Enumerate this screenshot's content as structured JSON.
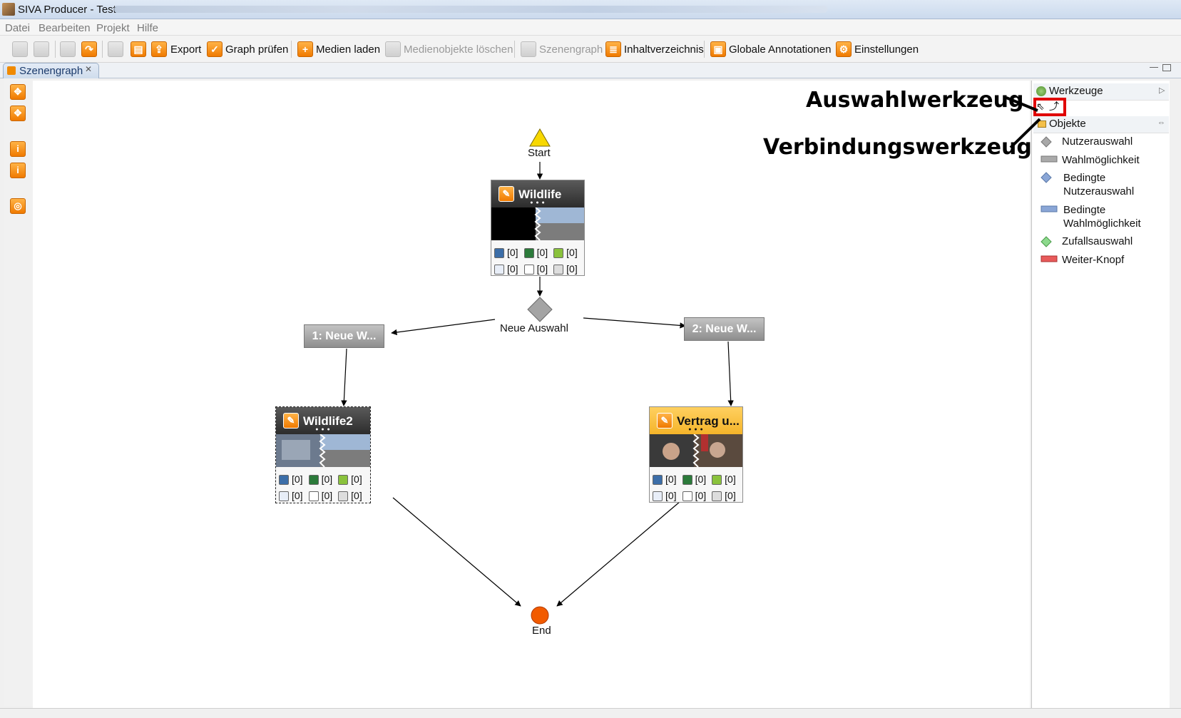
{
  "window": {
    "title": "SIVA Producer - Test"
  },
  "menu": [
    "Datei",
    "Bearbeiten",
    "Projekt",
    "Hilfe"
  ],
  "toolbar": {
    "export": "Export",
    "graph_check": "Graph prüfen",
    "load_media": "Medien laden",
    "delete_media": "Medienobjekte löschen",
    "scenegraph": "Szenengraph",
    "toc": "Inhaltverzeichnis",
    "global_annotations": "Globale Annotationen",
    "settings": "Einstellungen"
  },
  "tab": {
    "label": "Szenengraph",
    "close": "✕"
  },
  "graph": {
    "start": "Start",
    "end": "End",
    "decision": "Neue Auswahl",
    "choice1": "1: Neue W...",
    "choice2": "2: Neue W...",
    "count": "[0]",
    "scenes": [
      {
        "name": "Wildlife"
      },
      {
        "name": "Wildlife2"
      },
      {
        "name": "Vertrag u..."
      }
    ]
  },
  "palette": {
    "tools_header": "Werkzeuge",
    "objects_header": "Objekte",
    "items": [
      "Nutzerauswahl",
      "Wahlmöglichkeit",
      "Bedingte Nutzerauswahl",
      "Bedingte Wahlmöglichkeit",
      "Zufallsauswahl",
      "Weiter-Knopf"
    ],
    "item_lines": {
      "cond_user_1": "Bedingte",
      "cond_user_2": "Nutzerauswahl",
      "cond_choice_1": "Bedingte",
      "cond_choice_2": "Wahlmöglichkeit"
    }
  },
  "annotations": {
    "selection_tool": "Auswahlwerkzeug",
    "connection_tool": "Verbindungswerkzeug",
    "highlight_color": "#e00000"
  }
}
